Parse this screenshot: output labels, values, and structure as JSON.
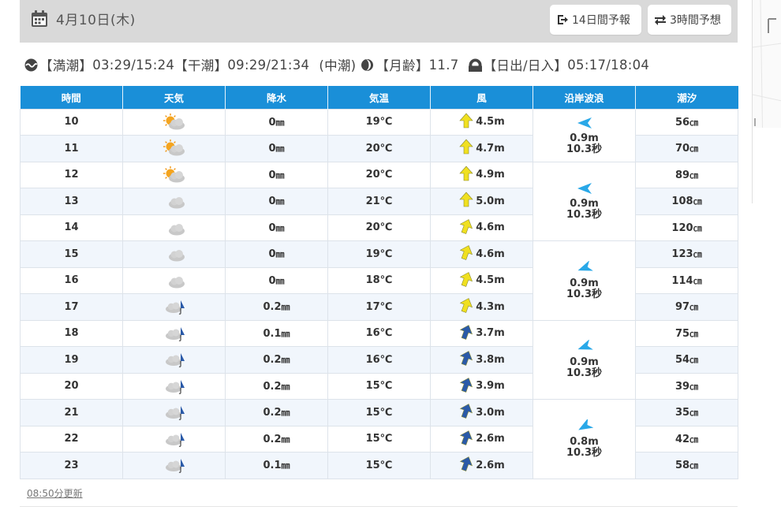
{
  "header": {
    "date": "4月10日(木)",
    "btn_14day": "14日間予報",
    "btn_3hour": "3時間予想"
  },
  "info": {
    "high_tide_label": "【満潮】",
    "high_tide": "03:29/15:24",
    "low_tide_label": "【干潮】",
    "low_tide": "09:29/21:34",
    "tide_type": "(中潮)",
    "moon_label": "【月齢】",
    "moon_age": "11.7",
    "sun_label": "【日出/日入】",
    "sun": "05:17/18:04"
  },
  "table": {
    "columns": [
      "時間",
      "天気",
      "降水",
      "気温",
      "風",
      "沿岸波浪",
      "潮汐"
    ],
    "rows": [
      {
        "hour": "10",
        "weather": "sun-cloud",
        "precip": "0",
        "temp": "19℃",
        "wind": "4.5m",
        "wind_color": "#f0e020",
        "wind_dir": 0,
        "tide": "56"
      },
      {
        "hour": "11",
        "weather": "sun-cloud",
        "precip": "0",
        "temp": "20℃",
        "wind": "4.7m",
        "wind_color": "#f0e020",
        "wind_dir": 0,
        "tide": "70"
      },
      {
        "hour": "12",
        "weather": "sun-cloud",
        "precip": "0",
        "temp": "20℃",
        "wind": "4.9m",
        "wind_color": "#f0e020",
        "wind_dir": 0,
        "tide": "89"
      },
      {
        "hour": "13",
        "weather": "cloud",
        "precip": "0",
        "temp": "21℃",
        "wind": "5.0m",
        "wind_color": "#f0e020",
        "wind_dir": 0,
        "tide": "108"
      },
      {
        "hour": "14",
        "weather": "cloud",
        "precip": "0",
        "temp": "20℃",
        "wind": "4.6m",
        "wind_color": "#f0e020",
        "wind_dir": 20,
        "tide": "120"
      },
      {
        "hour": "15",
        "weather": "cloud",
        "precip": "0",
        "temp": "19℃",
        "wind": "4.6m",
        "wind_color": "#f0e020",
        "wind_dir": 20,
        "tide": "123"
      },
      {
        "hour": "16",
        "weather": "cloud",
        "precip": "0",
        "temp": "18℃",
        "wind": "4.5m",
        "wind_color": "#f0e020",
        "wind_dir": 20,
        "tide": "114"
      },
      {
        "hour": "17",
        "weather": "cloud-rain",
        "precip": "0.2",
        "temp": "17℃",
        "wind": "4.3m",
        "wind_color": "#f0e020",
        "wind_dir": 20,
        "tide": "97"
      },
      {
        "hour": "18",
        "weather": "cloud-rain",
        "precip": "0.1",
        "temp": "16℃",
        "wind": "3.7m",
        "wind_color": "#2a5aa8",
        "wind_dir": 20,
        "tide": "75"
      },
      {
        "hour": "19",
        "weather": "cloud-rain",
        "precip": "0.2",
        "temp": "16℃",
        "wind": "3.8m",
        "wind_color": "#2a5aa8",
        "wind_dir": 20,
        "tide": "54"
      },
      {
        "hour": "20",
        "weather": "cloud-rain",
        "precip": "0.2",
        "temp": "15℃",
        "wind": "3.9m",
        "wind_color": "#2a5aa8",
        "wind_dir": 20,
        "tide": "39"
      },
      {
        "hour": "21",
        "weather": "cloud-rain",
        "precip": "0.2",
        "temp": "15℃",
        "wind": "3.0m",
        "wind_color": "#2a5aa8",
        "wind_dir": 20,
        "tide": "35"
      },
      {
        "hour": "22",
        "weather": "cloud-rain",
        "precip": "0.2",
        "temp": "15℃",
        "wind": "2.6m",
        "wind_color": "#2a5aa8",
        "wind_dir": 20,
        "tide": "42"
      },
      {
        "hour": "23",
        "weather": "cloud-rain",
        "precip": "0.1",
        "temp": "15℃",
        "wind": "2.6m",
        "wind_color": "#2a5aa8",
        "wind_dir": 20,
        "tide": "58"
      }
    ],
    "waves": [
      {
        "span": 2,
        "height": "0.9m",
        "period": "10.3秒",
        "dir": 180
      },
      {
        "span": 3,
        "height": "0.9m",
        "period": "10.3秒",
        "dir": 180
      },
      {
        "span": 3,
        "height": "0.9m",
        "period": "10.3秒",
        "dir": 160
      },
      {
        "span": 3,
        "height": "0.9m",
        "period": "10.3秒",
        "dir": 160
      },
      {
        "span": 3,
        "height": "0.8m",
        "period": "10.3秒",
        "dir": 150
      }
    ],
    "precip_unit": "㎜",
    "tide_unit": "㎝"
  },
  "footer": {
    "updated": "08:50分更新"
  },
  "colors": {
    "header_blue": "#1a8fd8",
    "wave_arrow": "#29a8e8"
  }
}
